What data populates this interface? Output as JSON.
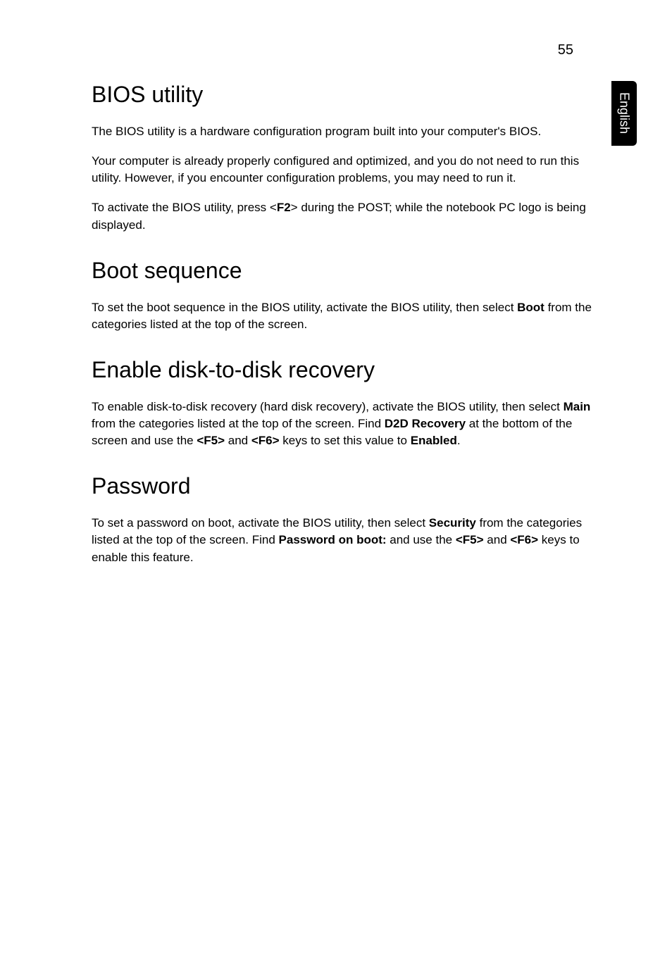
{
  "page_number": "55",
  "side_tab": "English",
  "sections": {
    "bios_utility": {
      "heading": "BIOS utility",
      "p1": "The BIOS utility is a hardware configuration program built into your computer's BIOS.",
      "p2": "Your computer is already properly configured and optimized, and you do not need to run this utility. However, if you encounter configuration problems, you may need to run it.",
      "p3_a": "To activate the BIOS utility, press <",
      "p3_b": "F2",
      "p3_c": "> during the POST; while the notebook PC logo is being displayed."
    },
    "boot_sequence": {
      "heading": "Boot sequence",
      "p1_a": "To set the boot sequence in the BIOS utility, activate the BIOS utility, then select ",
      "p1_b": "Boot",
      "p1_c": " from the categories listed at the top of the screen."
    },
    "d2d": {
      "heading": "Enable disk-to-disk recovery",
      "p1_a": "To enable disk-to-disk recovery (hard disk recovery), activate the BIOS utility, then select ",
      "p1_b": "Main",
      "p1_c": " from the categories listed at the top of the screen. Find ",
      "p1_d": "D2D Recovery",
      "p1_e": " at the bottom of the screen and use the ",
      "p1_f": "<F5>",
      "p1_g": " and ",
      "p1_h": "<F6>",
      "p1_i": " keys to set this value to ",
      "p1_j": "Enabled",
      "p1_k": "."
    },
    "password": {
      "heading": "Password",
      "p1_a": "To set a password on boot, activate the BIOS utility, then select ",
      "p1_b": "Security",
      "p1_c": " from the categories listed at the top of the screen. Find ",
      "p1_d": "Password on boot:",
      "p1_e": " and use the ",
      "p1_f": "<F5>",
      "p1_g": " and ",
      "p1_h": "<F6>",
      "p1_i": " keys to enable this feature."
    }
  }
}
